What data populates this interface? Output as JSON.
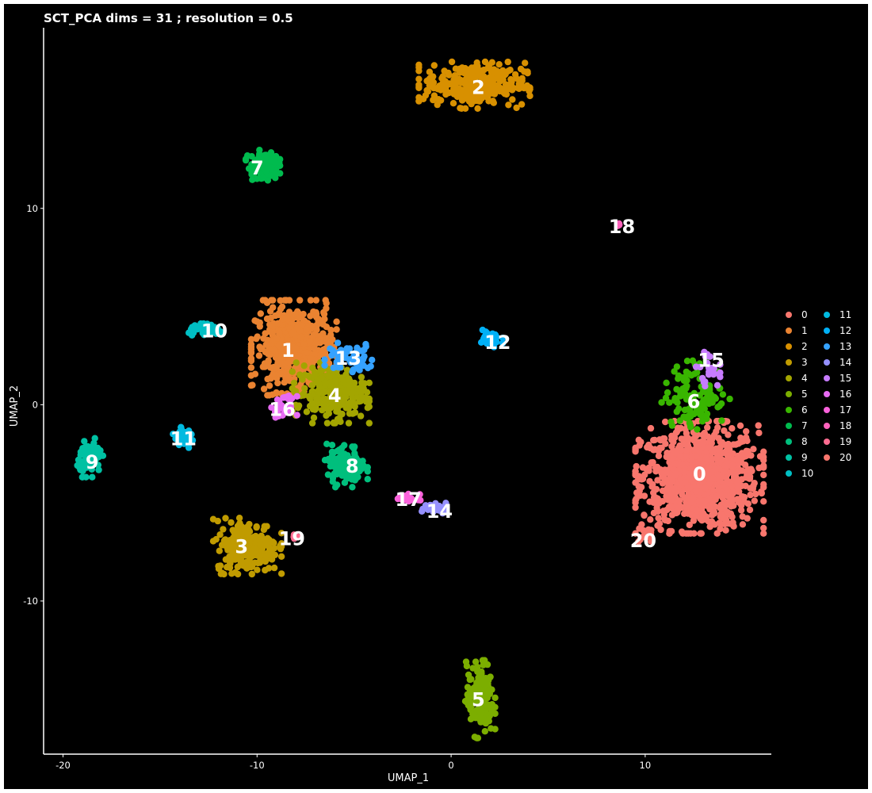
{
  "chart_data": {
    "type": "scatter",
    "title": "SCT_PCA dims =  31 ; resolution = 0.5",
    "xlabel": "UMAP_1",
    "ylabel": "UMAP_2",
    "xlim": [
      -21,
      16.5
    ],
    "ylim": [
      -17.8,
      19.2
    ],
    "xticks": [
      -20,
      -10,
      0,
      10
    ],
    "yticks": [
      -10,
      0,
      10
    ],
    "xtick_labels": [
      "-20",
      "-10",
      "0",
      "10"
    ],
    "ytick_labels": [
      "-10",
      "0",
      "10"
    ],
    "grid": false,
    "legend_position": "right",
    "legend_columns": 2,
    "clusters": [
      {
        "name": "0",
        "color": "#F8766D",
        "centroid": [
          12.8,
          -3.7
        ],
        "spread": [
          1.5,
          1.3
        ],
        "n": 900
      },
      {
        "name": "1",
        "color": "#EA8331",
        "centroid": [
          -8.1,
          2.9
        ],
        "spread": [
          1.0,
          1.1
        ],
        "n": 500
      },
      {
        "name": "2",
        "color": "#D89000",
        "centroid": [
          1.2,
          16.3
        ],
        "spread": [
          1.3,
          0.55
        ],
        "n": 300
      },
      {
        "name": "3",
        "color": "#C09B00",
        "centroid": [
          -10.5,
          -7.2
        ],
        "spread": [
          0.8,
          0.65
        ],
        "n": 260
      },
      {
        "name": "4",
        "color": "#A3A500",
        "centroid": [
          -6.2,
          0.6
        ],
        "spread": [
          0.9,
          0.7
        ],
        "n": 260
      },
      {
        "name": "5",
        "color": "#7CAE00",
        "centroid": [
          1.5,
          -15.0
        ],
        "spread": [
          0.35,
          0.9
        ],
        "n": 160
      },
      {
        "name": "6",
        "color": "#39B600",
        "centroid": [
          12.6,
          0.5
        ],
        "spread": [
          0.8,
          0.8
        ],
        "n": 120
      },
      {
        "name": "7",
        "color": "#00BB4E",
        "centroid": [
          -9.7,
          12.2
        ],
        "spread": [
          0.4,
          0.35
        ],
        "n": 110
      },
      {
        "name": "8",
        "color": "#00BF7D",
        "centroid": [
          -5.4,
          -3.1
        ],
        "spread": [
          0.5,
          0.5
        ],
        "n": 120
      },
      {
        "name": "9",
        "color": "#00C1A3",
        "centroid": [
          -18.6,
          -2.7
        ],
        "spread": [
          0.3,
          0.45
        ],
        "n": 70
      },
      {
        "name": "10",
        "color": "#00BFC4",
        "centroid": [
          -12.6,
          3.8
        ],
        "spread": [
          0.45,
          0.15
        ],
        "n": 50
      },
      {
        "name": "11",
        "color": "#00BAE0",
        "centroid": [
          -13.8,
          -1.7
        ],
        "spread": [
          0.3,
          0.25
        ],
        "n": 40
      },
      {
        "name": "12",
        "color": "#00B0F6",
        "centroid": [
          2.0,
          3.3
        ],
        "spread": [
          0.3,
          0.25
        ],
        "n": 40
      },
      {
        "name": "13",
        "color": "#35A2FF",
        "centroid": [
          -5.2,
          2.4
        ],
        "spread": [
          0.6,
          0.35
        ],
        "n": 60
      },
      {
        "name": "14",
        "color": "#9590FF",
        "centroid": [
          -0.8,
          -5.2
        ],
        "spread": [
          0.5,
          0.15
        ],
        "n": 30
      },
      {
        "name": "15",
        "color": "#C77CFF",
        "centroid": [
          13.2,
          1.8
        ],
        "spread": [
          0.3,
          0.4
        ],
        "n": 25
      },
      {
        "name": "16",
        "color": "#E76BF3",
        "centroid": [
          -8.6,
          -0.1
        ],
        "spread": [
          0.3,
          0.25
        ],
        "n": 30
      },
      {
        "name": "17",
        "color": "#FA62DB",
        "centroid": [
          -2.2,
          -4.8
        ],
        "spread": [
          0.3,
          0.12
        ],
        "n": 20
      },
      {
        "name": "18",
        "color": "#FF62BC",
        "centroid": [
          8.7,
          9.2
        ],
        "spread": [
          0.05,
          0.05
        ],
        "n": 4
      },
      {
        "name": "19",
        "color": "#FF6C91",
        "centroid": [
          -8.1,
          -6.7
        ],
        "spread": [
          0.1,
          0.1
        ],
        "n": 8
      },
      {
        "name": "20",
        "color": "#F8766D",
        "centroid": [
          10.1,
          -6.7
        ],
        "spread": [
          0.25,
          0.2
        ],
        "n": 12
      }
    ],
    "cluster_labels": [
      {
        "text": "0",
        "x": 12.8,
        "y": -3.5
      },
      {
        "text": "1",
        "x": -8.4,
        "y": 2.8
      },
      {
        "text": "2",
        "x": 1.4,
        "y": 16.2
      },
      {
        "text": "3",
        "x": -10.8,
        "y": -7.2
      },
      {
        "text": "4",
        "x": -6.0,
        "y": 0.5
      },
      {
        "text": "5",
        "x": 1.4,
        "y": -15.0
      },
      {
        "text": "6",
        "x": 12.5,
        "y": 0.2
      },
      {
        "text": "7",
        "x": -10.0,
        "y": 12.1
      },
      {
        "text": "8",
        "x": -5.1,
        "y": -3.1
      },
      {
        "text": "9",
        "x": -18.5,
        "y": -2.9
      },
      {
        "text": "10",
        "x": -12.2,
        "y": 3.8
      },
      {
        "text": "11",
        "x": -13.8,
        "y": -1.7
      },
      {
        "text": "12",
        "x": 2.4,
        "y": 3.2
      },
      {
        "text": "13",
        "x": -5.3,
        "y": 2.4
      },
      {
        "text": "14",
        "x": -0.6,
        "y": -5.4
      },
      {
        "text": "15",
        "x": 13.4,
        "y": 2.3
      },
      {
        "text": "16",
        "x": -8.7,
        "y": -0.2
      },
      {
        "text": "17",
        "x": -2.2,
        "y": -4.8
      },
      {
        "text": "18",
        "x": 8.8,
        "y": 9.1
      },
      {
        "text": "19",
        "x": -8.2,
        "y": -6.8
      },
      {
        "text": "20",
        "x": 9.9,
        "y": -6.9
      }
    ]
  }
}
